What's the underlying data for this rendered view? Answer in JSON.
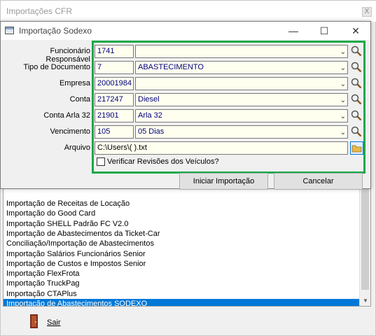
{
  "bg_window": {
    "title": "Importações CFR",
    "close_label": "X"
  },
  "list": {
    "items": [
      "Importação de Receitas de Locação",
      "Importação do Good Card",
      "Importação SHELL Padrão FC V2.0",
      "Importação de Abastecimentos da Ticket-Car",
      "Conciliação/Importação de Abastecimentos",
      "Importação Salários Funcionários Senior",
      "Importação de Custos e Impostos Senior",
      "Importação FlexFrota",
      "Importação TruckPag",
      "Importação CTAPlus",
      "Importação de Abastecimentos SODEXO"
    ],
    "selected_index": 10
  },
  "exit": {
    "label": "Sair"
  },
  "dialog": {
    "title": "Importação Sodexo",
    "fields": {
      "funcionario": {
        "label": "Funcionário Responsável",
        "code": "1741",
        "desc": ""
      },
      "tipo_documento": {
        "label": "Tipo de Documento",
        "code": "7",
        "desc": "ABASTECIMENTO"
      },
      "empresa": {
        "label": "Empresa",
        "code": "20001984",
        "desc": ""
      },
      "conta": {
        "label": "Conta",
        "code": "217247",
        "desc": "Diesel"
      },
      "conta_arla": {
        "label": "Conta Arla 32",
        "code": "21901",
        "desc": "Arla 32"
      },
      "vencimento": {
        "label": "Vencimento",
        "code": "105",
        "desc": "05 Dias"
      },
      "arquivo": {
        "label": "Arquivo",
        "value": "C:\\Users\\(                                               ).txt"
      }
    },
    "checkbox_label": "Verificar Revisões dos Veículos?",
    "checkbox_checked": false,
    "btn_start": "Iniciar Importação",
    "btn_cancel": "Cancelar"
  },
  "colors": {
    "accent": "#0078d7",
    "group_border": "#1aa84a",
    "field_bg": "#fffff0",
    "field_text": "#00007a"
  }
}
